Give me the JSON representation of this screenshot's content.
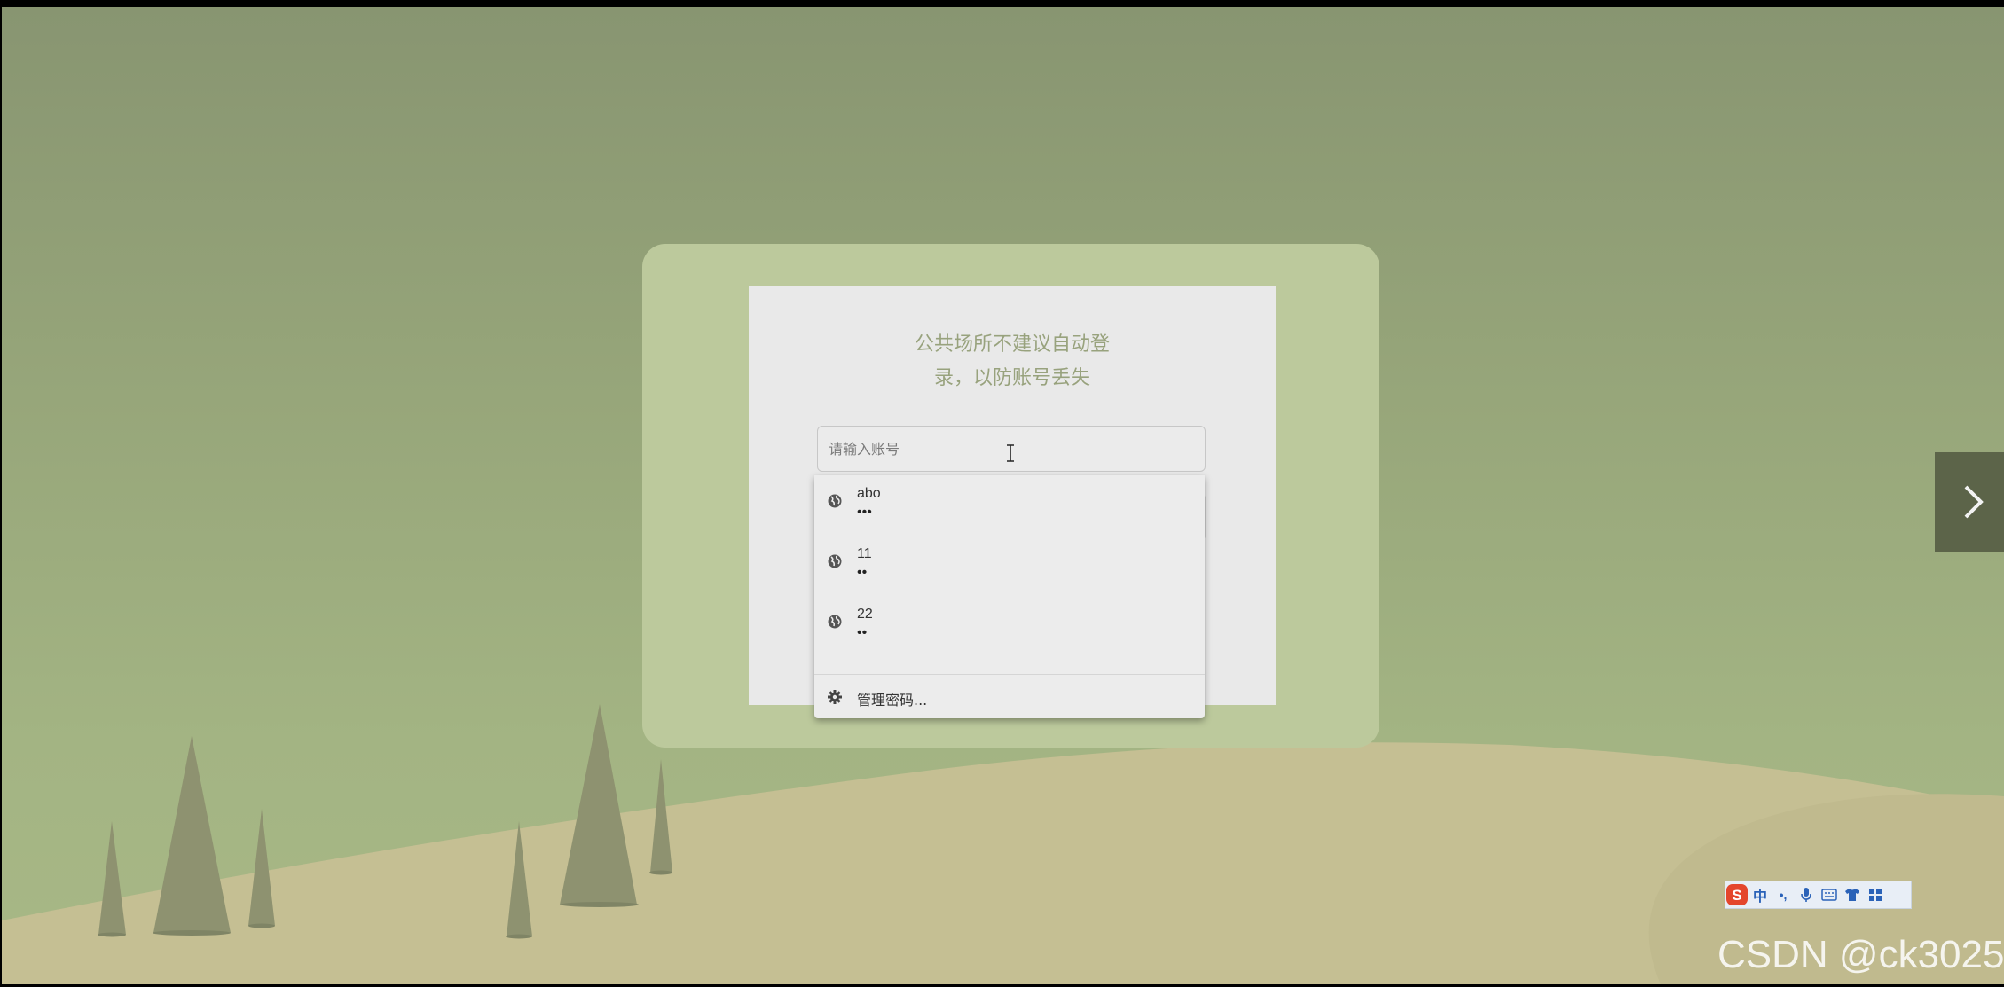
{
  "login": {
    "notice_line1": "公共场所不建议自动登",
    "notice_line2": "录，以防账号丢失",
    "account_placeholder": "请输入账号"
  },
  "autofill": {
    "items": [
      {
        "username": "abo",
        "password_mask": "•••"
      },
      {
        "username": "11",
        "password_mask": "••"
      },
      {
        "username": "22",
        "password_mask": "••"
      }
    ],
    "item_icon": "globe-icon",
    "manage_label": "管理密码...",
    "manage_icon": "gear-icon"
  },
  "carousel": {
    "next_icon": "chevron-right-icon"
  },
  "ime_toolbar": {
    "logo_icon": "sogou-s-icon",
    "mode_label": "中",
    "punct_label": "•,",
    "icons": [
      "microphone-icon",
      "keyboard-icon",
      "shirt-icon",
      "grid-icon"
    ]
  },
  "watermark": "CSDN @ck3025",
  "colors": {
    "sky": "#97a67a",
    "card": "#bcc99c",
    "panel": "#e9e9e9",
    "hill": "#c5bf94",
    "tree": "#8e9270",
    "arrow_bg": "#5c6449"
  }
}
